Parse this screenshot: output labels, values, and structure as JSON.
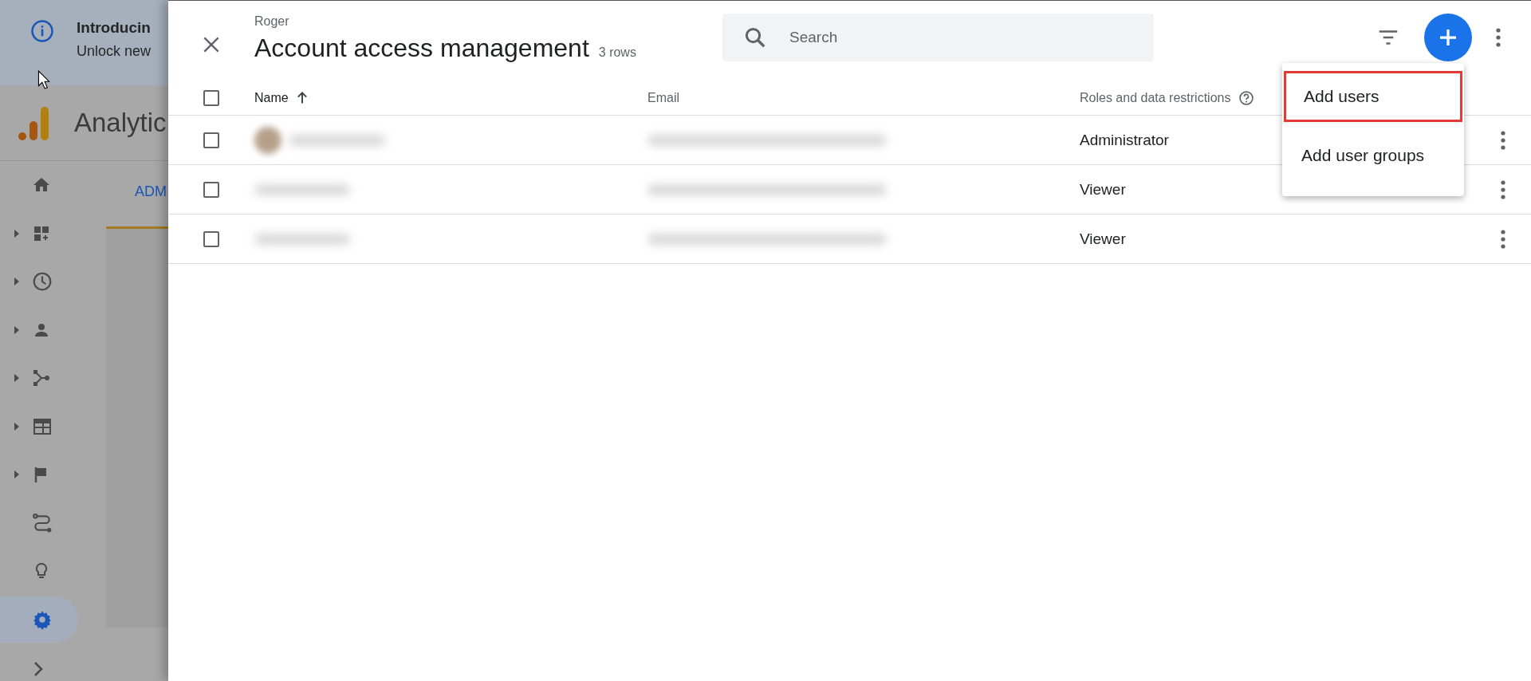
{
  "background": {
    "banner": {
      "title": "Introducin",
      "subtitle": "Unlock new"
    },
    "app_name": "Analytic",
    "tab": "ADM",
    "nav": [
      {
        "kind": "home",
        "expandable": false,
        "selected": false
      },
      {
        "kind": "dashboard",
        "expandable": true,
        "selected": false
      },
      {
        "kind": "clock",
        "expandable": true,
        "selected": false
      },
      {
        "kind": "person",
        "expandable": true,
        "selected": false
      },
      {
        "kind": "fork",
        "expandable": true,
        "selected": false
      },
      {
        "kind": "browser",
        "expandable": true,
        "selected": false
      },
      {
        "kind": "flag",
        "expandable": true,
        "selected": false
      },
      {
        "kind": "route",
        "expandable": false,
        "selected": false
      },
      {
        "kind": "bulb",
        "expandable": false,
        "selected": false
      },
      {
        "kind": "gear",
        "expandable": false,
        "selected": true
      }
    ]
  },
  "panel": {
    "account": "Roger",
    "title": "Account access management",
    "row_count": "3 rows",
    "search": {
      "placeholder": "Search"
    },
    "select_all": {
      "checked": false
    },
    "columns": [
      {
        "label": "Name",
        "kind": "sorted"
      },
      {
        "label": "Email",
        "kind": "plain"
      },
      {
        "label": "Roles and data restrictions",
        "kind": "help"
      }
    ],
    "rows": [
      {
        "checked": false,
        "avatar": true,
        "role": "Administrator"
      },
      {
        "checked": false,
        "avatar": false,
        "role": "Viewer"
      },
      {
        "checked": false,
        "avatar": false,
        "role": "Viewer"
      }
    ],
    "menu": [
      {
        "label": "Add users",
        "highlighted": true
      },
      {
        "label": "Add user groups",
        "highlighted": false
      }
    ]
  }
}
